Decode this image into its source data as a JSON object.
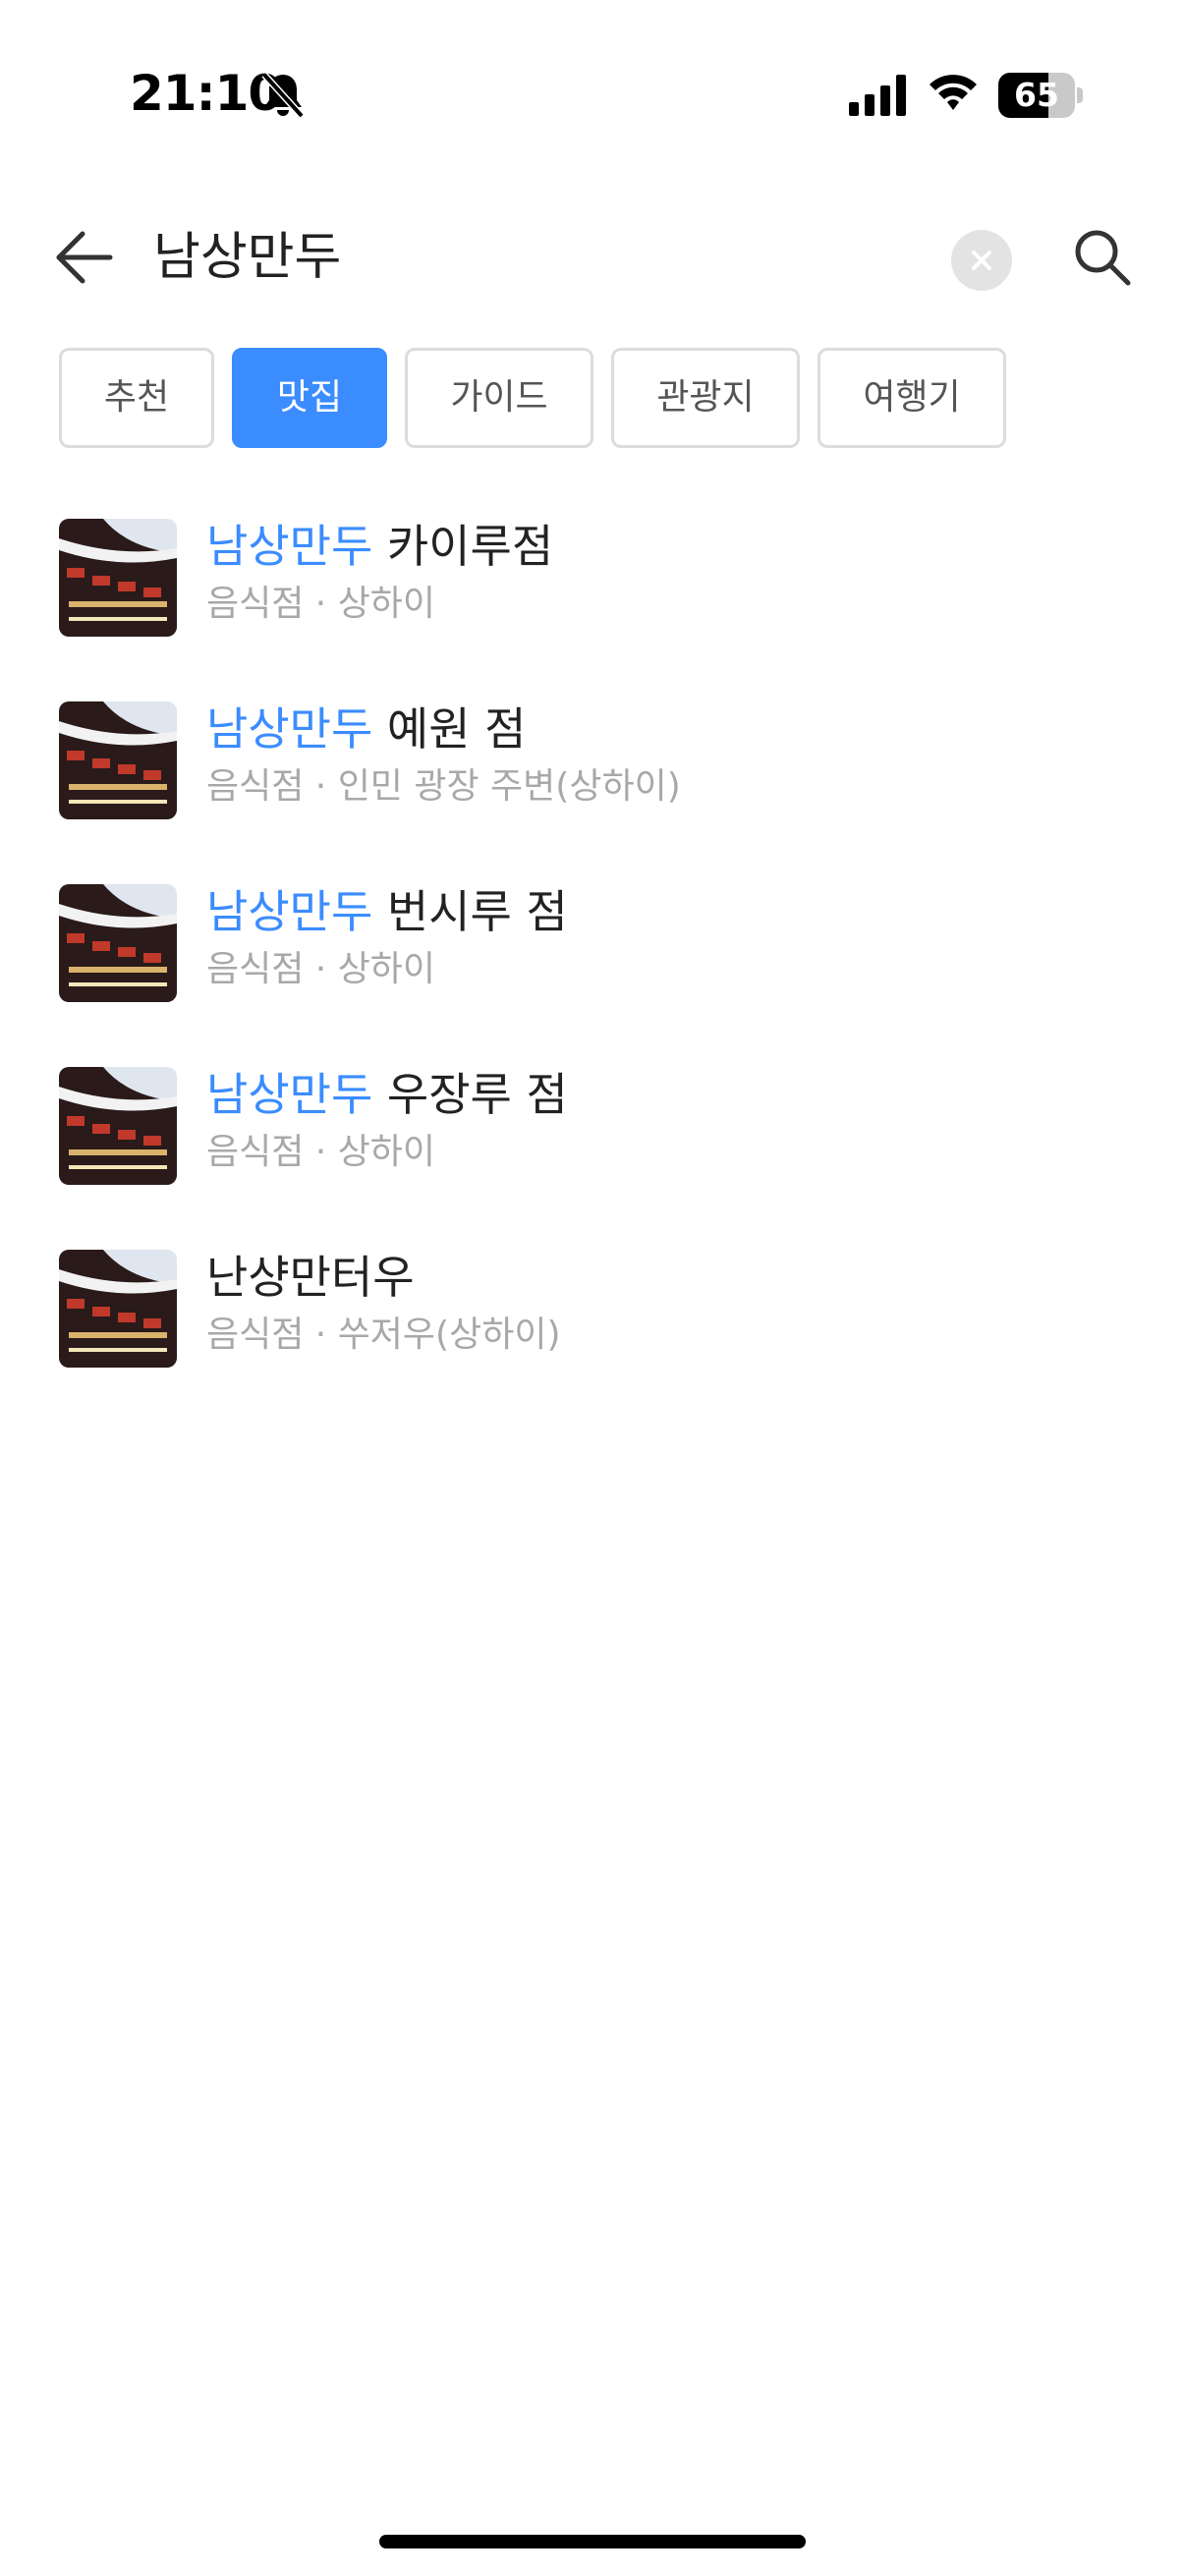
{
  "status_bar": {
    "time": "21:10",
    "battery": "65",
    "battery_level": 0.65
  },
  "search": {
    "query": "남상만두"
  },
  "tabs": [
    {
      "label": "추천",
      "active": false
    },
    {
      "label": "맛집",
      "active": true
    },
    {
      "label": "가이드",
      "active": false
    },
    {
      "label": "관광지",
      "active": false
    },
    {
      "label": "여행기",
      "active": false
    }
  ],
  "results": [
    {
      "highlight": "남상만두",
      "rest": " 카이루점",
      "meta": "음식점 · 상하이"
    },
    {
      "highlight": "남상만두",
      "rest": " 예원 점",
      "meta": "음식점 · 인민 광장 주변(상하이)"
    },
    {
      "highlight": "남상만두",
      "rest": " 번시루 점",
      "meta": "음식점 · 상하이"
    },
    {
      "highlight": "남상만두",
      "rest": " 우장루 점",
      "meta": "음식점 · 상하이"
    },
    {
      "highlight": "",
      "rest": "난샹만터우",
      "meta": "음식점 · 쑤저우(상하이)"
    }
  ],
  "icons": {
    "back": "arrow-left-icon",
    "clear": "close-icon",
    "search": "search-icon",
    "bell": "bell-slash-icon",
    "signal": "cellular-signal-icon",
    "wifi": "wifi-icon"
  },
  "colors": {
    "accent": "#3b8cff",
    "meta_text": "#a8a8a8"
  }
}
